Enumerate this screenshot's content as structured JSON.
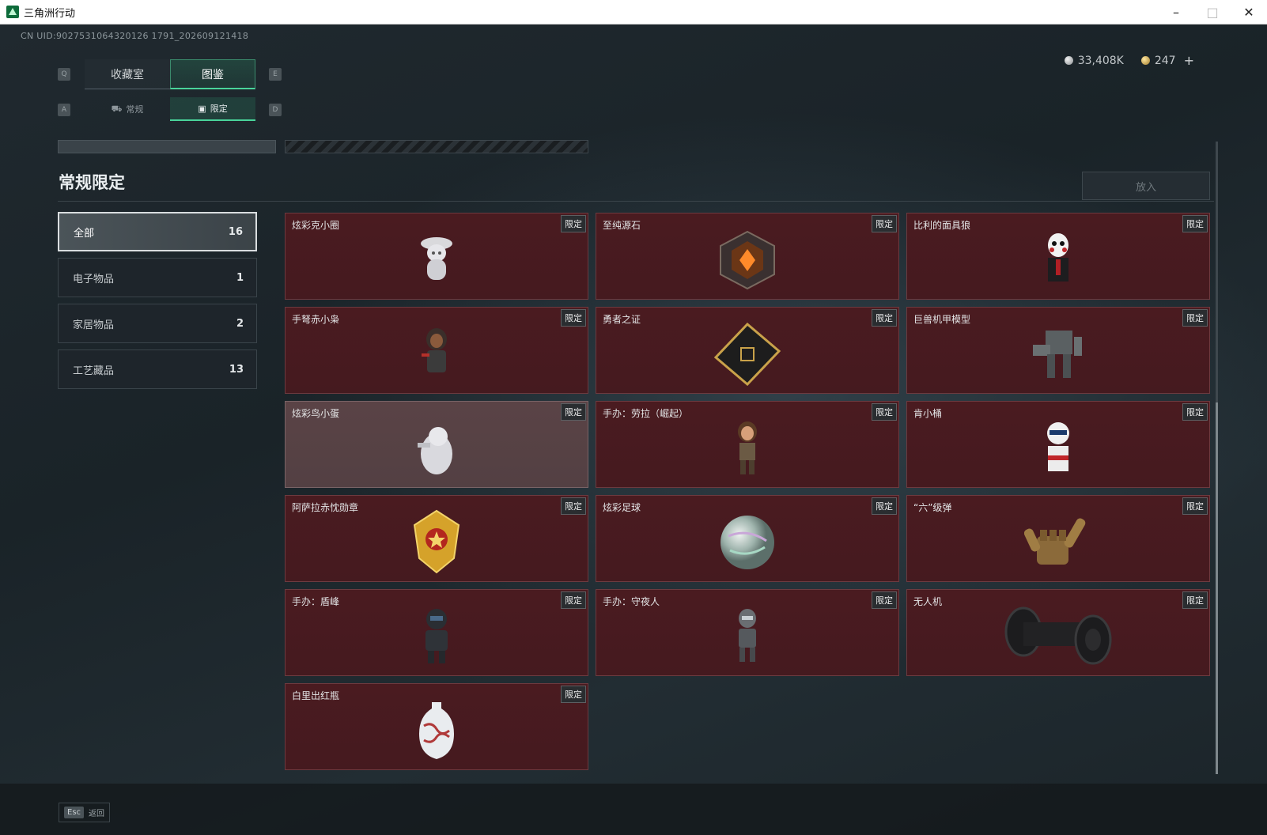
{
  "window": {
    "title": "三角洲行动"
  },
  "uid": "CN UID:9027531064320126 1791_202609121418",
  "currency": {
    "silver": "33,408K",
    "gold": "247",
    "plus": "+"
  },
  "keys": {
    "q": "Q",
    "e": "E",
    "a": "A",
    "d": "D",
    "esc": "Esc"
  },
  "tabs": [
    {
      "label": "收藏室"
    },
    {
      "label": "图鉴"
    }
  ],
  "subtabs": [
    {
      "label": "常规"
    },
    {
      "label": "限定"
    }
  ],
  "section_title": "常规限定",
  "put_button": "放入",
  "categories": [
    {
      "label": "全部",
      "count": "16"
    },
    {
      "label": "电子物品",
      "count": "1"
    },
    {
      "label": "家居物品",
      "count": "2"
    },
    {
      "label": "工艺藏品",
      "count": "13"
    }
  ],
  "badge": "限定",
  "items": [
    {
      "name": "炫彩克小圈",
      "icon": "figurine-icon"
    },
    {
      "name": "至纯源石",
      "icon": "crystal-icon"
    },
    {
      "name": "比利的面具狼",
      "icon": "puppet-icon"
    },
    {
      "name": "手弩赤小枭",
      "icon": "hooded-figure-icon"
    },
    {
      "name": "勇者之证",
      "icon": "card-icon"
    },
    {
      "name": "巨兽机甲模型",
      "icon": "mech-icon"
    },
    {
      "name": "炫彩鸟小蛋",
      "icon": "egg-icon"
    },
    {
      "name": "手办：劳拉（崛起）",
      "icon": "figure-icon"
    },
    {
      "name": "肯小桶",
      "icon": "bucket-figure-icon"
    },
    {
      "name": "阿萨拉赤忱勋章",
      "icon": "medal-icon"
    },
    {
      "name": "炫彩足球",
      "icon": "ball-icon"
    },
    {
      "name": "“六”级弹",
      "icon": "hand-icon"
    },
    {
      "name": "手办：盾峰",
      "icon": "soldier-figure-icon"
    },
    {
      "name": "手办：守夜人",
      "icon": "robot-figure-icon"
    },
    {
      "name": "无人机",
      "icon": "roller-icon"
    },
    {
      "name": "白里出红瓶",
      "icon": "vase-icon"
    }
  ],
  "footer": {
    "back": "返回"
  }
}
